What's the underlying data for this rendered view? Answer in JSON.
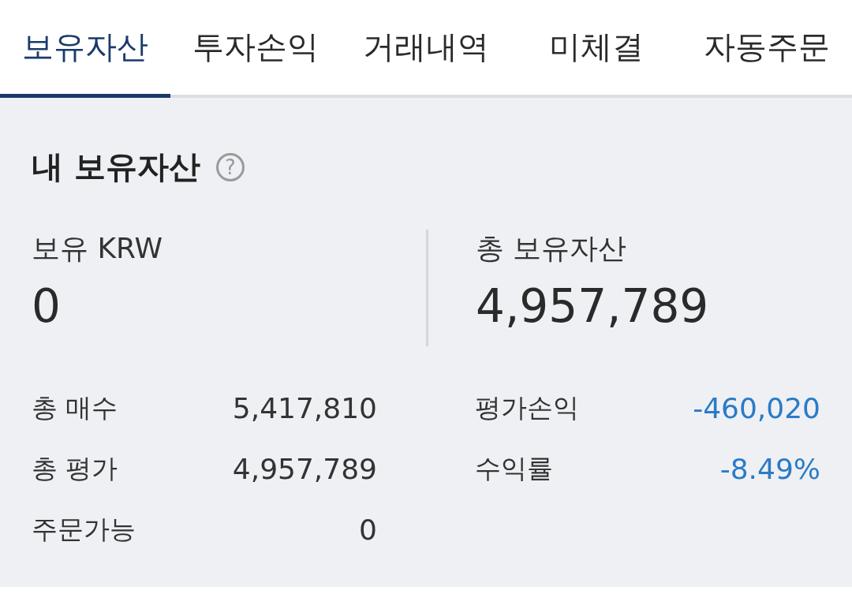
{
  "tabs": [
    {
      "label": "보유자산",
      "selected": true
    },
    {
      "label": "투자손익",
      "selected": false
    },
    {
      "label": "거래내역",
      "selected": false
    },
    {
      "label": "미체결",
      "selected": false
    },
    {
      "label": "자동주문",
      "selected": false
    }
  ],
  "summary": {
    "title": "내 보유자산",
    "help_icon": "?",
    "left": {
      "label": "보유 KRW",
      "value": "0"
    },
    "right": {
      "label": "총 보유자산",
      "value": "4,957,789"
    },
    "left_stats": [
      {
        "label": "총 매수",
        "value": "5,417,810",
        "color": "#333333"
      },
      {
        "label": "총 평가",
        "value": "4,957,789",
        "color": "#333333"
      },
      {
        "label": "주문가능",
        "value": "0",
        "color": "#333333"
      }
    ],
    "right_stats": [
      {
        "label": "평가손익",
        "value": "-460,020",
        "color": "#2b7bc6"
      },
      {
        "label": "수익률",
        "value": "-8.49%",
        "color": "#2b7bc6"
      }
    ]
  }
}
